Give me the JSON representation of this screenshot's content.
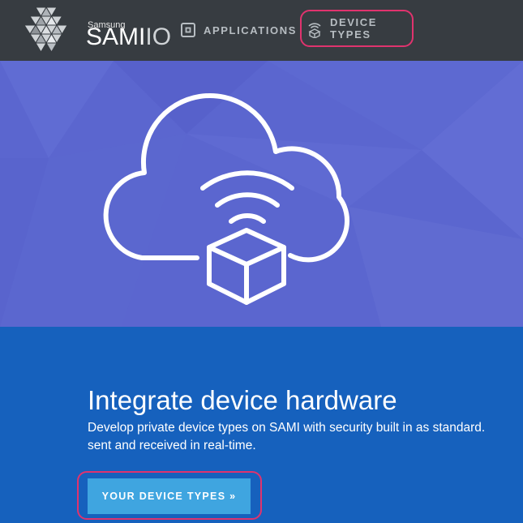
{
  "brand": {
    "small": "Samsung",
    "name": "SAMI",
    "suffix": "IO"
  },
  "nav": {
    "applications": "APPLICATIONS",
    "device_types": "DEVICE TYPES"
  },
  "main": {
    "title": "Integrate device hardware",
    "desc_line1": "Develop private device types on SAMI with security built in as standard.",
    "desc_line2": "sent and received in real-time.",
    "cta": "YOUR DEVICE TYPES »"
  },
  "colors": {
    "topbar": "#373c41",
    "hero": "#5b66cf",
    "content": "#1661bd",
    "button": "#3fa5e0",
    "highlight": "#e0336e"
  },
  "icons": [
    "samiio-logo-icon",
    "applications-icon",
    "device-types-icon",
    "cloud-device-illustration"
  ]
}
